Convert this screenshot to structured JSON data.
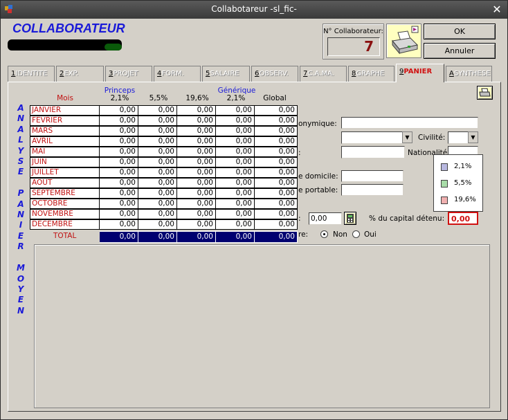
{
  "window": {
    "title": "Collabotareur -sl_fic-"
  },
  "header": {
    "heading": "COLLABORATEUR",
    "collab_number_label": "N° Collaborateur:",
    "collab_number": "7",
    "ok_label": "OK",
    "cancel_label": "Annuler"
  },
  "tabs": [
    {
      "num": "1",
      "label": "IDENTITE",
      "active": false
    },
    {
      "num": "2",
      "label": "EXP.",
      "active": false
    },
    {
      "num": "3",
      "label": "PROJET",
      "active": false
    },
    {
      "num": "4",
      "label": "FORM.",
      "active": false
    },
    {
      "num": "5",
      "label": "SALAIRE",
      "active": false
    },
    {
      "num": "6",
      "label": "OBSERV.",
      "active": false
    },
    {
      "num": "7",
      "label": "C.A.MA.",
      "active": false
    },
    {
      "num": "8",
      "label": "GRAPHE",
      "active": false
    },
    {
      "num": "9",
      "label": "PANIER",
      "active": true
    },
    {
      "num": "A",
      "label": "SYNTHESE",
      "active": false
    }
  ],
  "side_title": "ANALYSE PANIER MOYEN",
  "table": {
    "group_princeps": "Princeps",
    "group_generique": "Générique",
    "col_mois": "Mois",
    "columns": [
      "2,1%",
      "5,5%",
      "19,6%",
      "2,1%",
      "Global"
    ],
    "rows": [
      {
        "month": "JANVIER",
        "values": [
          "0,00",
          "0,00",
          "0,00",
          "0,00",
          "0,00"
        ]
      },
      {
        "month": "FEVRIER",
        "values": [
          "0,00",
          "0,00",
          "0,00",
          "0,00",
          "0,00"
        ]
      },
      {
        "month": "MARS",
        "values": [
          "0,00",
          "0,00",
          "0,00",
          "0,00",
          "0,00"
        ]
      },
      {
        "month": "AVRIL",
        "values": [
          "0,00",
          "0,00",
          "0,00",
          "0,00",
          "0,00"
        ]
      },
      {
        "month": "MAI",
        "values": [
          "0,00",
          "0,00",
          "0,00",
          "0,00",
          "0,00"
        ]
      },
      {
        "month": "JUIN",
        "values": [
          "0,00",
          "0,00",
          "0,00",
          "0,00",
          "0,00"
        ]
      },
      {
        "month": "JUILLET",
        "values": [
          "0,00",
          "0,00",
          "0,00",
          "0,00",
          "0,00"
        ]
      },
      {
        "month": "AOUT",
        "values": [
          "0,00",
          "0,00",
          "0,00",
          "0,00",
          "0,00"
        ]
      },
      {
        "month": "SEPTEMBRE",
        "values": [
          "0,00",
          "0,00",
          "0,00",
          "0,00",
          "0,00"
        ]
      },
      {
        "month": "OCTOBRE",
        "values": [
          "0,00",
          "0,00",
          "0,00",
          "0,00",
          "0,00"
        ]
      },
      {
        "month": "NOVEMBRE",
        "values": [
          "0,00",
          "0,00",
          "0,00",
          "0,00",
          "0,00"
        ]
      },
      {
        "month": "DECEMBRE",
        "values": [
          "0,00",
          "0,00",
          "0,00",
          "0,00",
          "0,00"
        ]
      }
    ],
    "total_label": "TOTAL",
    "totals": [
      "0,00",
      "0,00",
      "0,00",
      "0,00",
      "0,00"
    ]
  },
  "form": {
    "pseudonyme_label": "onymique:",
    "civilite_label": "Civilité:",
    "nationalite_label": "Nationalité:",
    "domicile_label": "e domicile:",
    "portable_label": "e portable:",
    "amount_label": ":",
    "amount_value": "0,00",
    "capital_label": "% du capital détenu:",
    "capital_value": "0,00",
    "radio_label_prefix": "re:",
    "radio_non": "Non",
    "radio_oui": "Oui"
  },
  "legend": [
    {
      "label": "2,1%",
      "color": "#b8b8e0"
    },
    {
      "label": "5,5%",
      "color": "#a8dca8"
    },
    {
      "label": "19,6%",
      "color": "#f0b0b0"
    }
  ],
  "colors": {
    "accent_blue": "#1a1ad8",
    "month_red": "#c01010",
    "total_navy": "#000070"
  }
}
